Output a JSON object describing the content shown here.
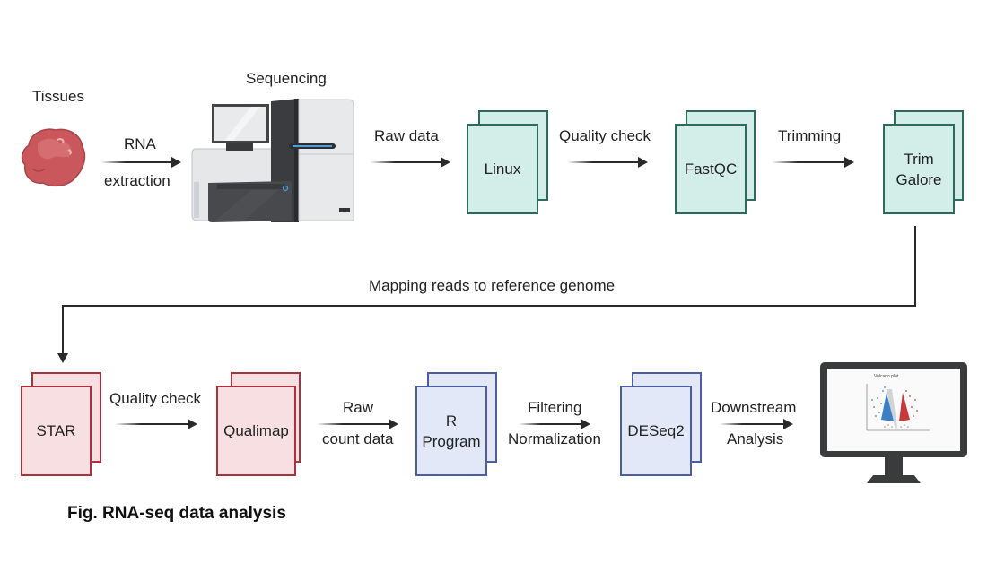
{
  "figure": {
    "caption": "Fig. RNA-seq data analysis",
    "colors": {
      "teal_fill": "#d3ede8",
      "teal_border": "#2c6a5c",
      "red_fill": "#f8dfe1",
      "red_border": "#a8323d",
      "blue_fill": "#e3e8f8",
      "blue_border": "#4a5ea0",
      "arrow": "#2a2a2a"
    }
  },
  "top_row": {
    "tissues_label": "Tissues",
    "tissue_icon": "tissue-sample-icon",
    "rna_extraction": [
      "RNA",
      "extraction"
    ],
    "sequencing_label": "Sequencing",
    "sequencer_icon": "sequencer-machine-icon",
    "raw_data_label": "Raw data",
    "linux_box": "Linux",
    "quality_check_label": "Quality check",
    "fastqc_box": "FastQC",
    "trimming_label": "Trimming",
    "trim_galore_box": [
      "Trim",
      "Galore"
    ]
  },
  "connector": {
    "label": "Mapping reads to reference genome"
  },
  "bottom_row": {
    "star_box": "STAR",
    "quality_check_label": "Quality check",
    "qualimap_box": "Qualimap",
    "raw_count": [
      "Raw",
      "count data"
    ],
    "r_program_box": [
      "R",
      "Program"
    ],
    "filtering": [
      "Filtering",
      "Normalization"
    ],
    "deseq2_box": "DESeq2",
    "downstream": [
      "Downstream",
      "Analysis"
    ],
    "monitor_icon": "monitor-volcano-plot-icon",
    "monitor_plot_title": "Volcano plot"
  }
}
